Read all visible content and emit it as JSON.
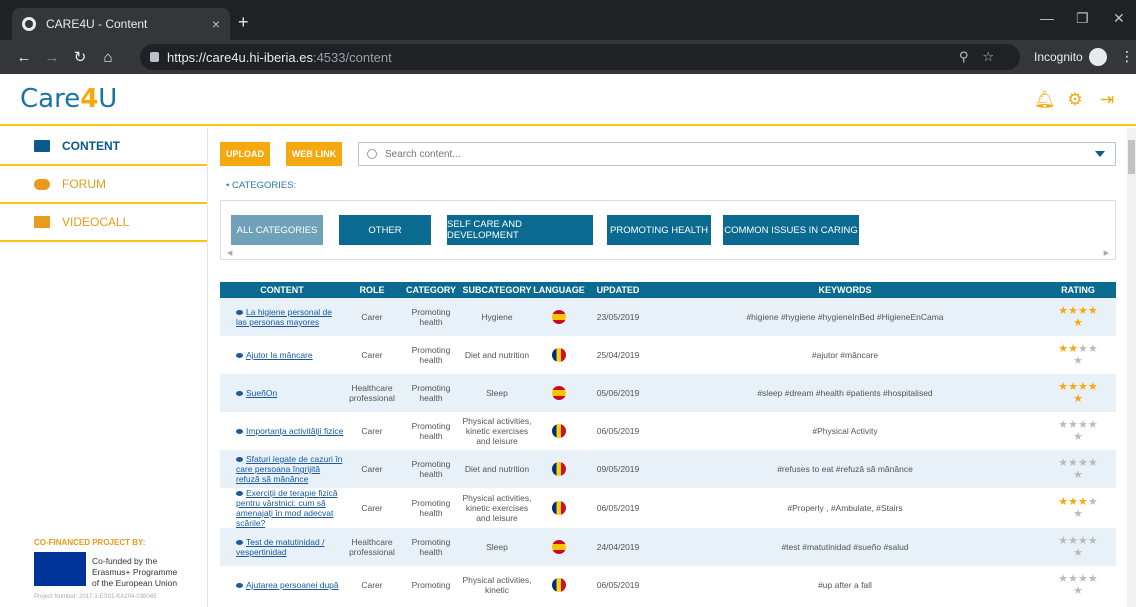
{
  "browser": {
    "tab_title": "CARE4U - Content",
    "tab_close": "×",
    "new_tab": "+",
    "url_main": "https://care4u.hi-iberia.es",
    "url_rest": ":4533/content",
    "incognito_label": "Incognito"
  },
  "header": {
    "logo_prefix": "Care",
    "logo_four": "4",
    "logo_suffix": "U"
  },
  "sidebar": {
    "items": [
      {
        "label": "CONTENT"
      },
      {
        "label": "FORUM"
      },
      {
        "label": "VIDEOCALL"
      }
    ],
    "cofinanced": "CO-FINANCED PROJECT BY:",
    "eu_line1": "Co-funded by the",
    "eu_line2": "Erasmus+ Programme",
    "eu_line3": "of the European Union",
    "project_number": "Project Number: 2017-1-ES01-KA204-038045"
  },
  "toolbar": {
    "upload_label": "UPLOAD",
    "weblink_label": "WEB LINK",
    "search_placeholder": "Search content..."
  },
  "categories": {
    "label": "•  CATEGORIES:",
    "items": [
      "ALL CATEGORIES",
      "OTHER",
      "SELF CARE AND DEVELOPMENT",
      "PROMOTING HEALTH",
      "COMMON ISSUES IN CARING"
    ],
    "selected": "ALL CATEGORIES"
  },
  "table": {
    "headers": [
      "CONTENT",
      "ROLE",
      "CATEGORY",
      "SUBCATEGORY",
      "LANGUAGE",
      "UPDATED",
      "KEYWORDS",
      "RATING"
    ],
    "rows": [
      {
        "content": "La higiene personal de las personas mayores",
        "role": "Carer",
        "category": "Promoting health",
        "subcategory": "Hygiene",
        "language": "es",
        "updated": "23/05/2019",
        "keywords": "#higiene #hygiene #hygieneInBed #HigieneEnCama",
        "rating": 5
      },
      {
        "content": "Ajutor la mâncare",
        "role": "Carer",
        "category": "Promoting health",
        "subcategory": "Diet and nutrition",
        "language": "ro",
        "updated": "25/04/2019",
        "keywords": "#ajutor #mâncare",
        "rating": 2
      },
      {
        "content": "SueñOn",
        "role": "Healthcare professional",
        "category": "Promoting health",
        "subcategory": "Sleep",
        "language": "es",
        "updated": "05/06/2019",
        "keywords": "#sleep #dream #health #patients #hospitalised",
        "rating": 5
      },
      {
        "content": "Importanța activității fizice",
        "role": "Carer",
        "category": "Promoting health",
        "subcategory": "Physical activities, kinetic exercises and leisure",
        "language": "ro",
        "updated": "06/05/2019",
        "keywords": "#Physical Activity",
        "rating": 0
      },
      {
        "content": "Sfaturi legate de cazuri în care persoana îngrijită refuză să mănânce",
        "role": "Carer",
        "category": "Promoting health",
        "subcategory": "Diet and nutrition",
        "language": "ro",
        "updated": "09/05/2019",
        "keywords": "#refuses to eat #refuză să mănânce",
        "rating": 0
      },
      {
        "content": "Exerciții de terapie fizică pentru vârstnici: cum să amenajați în mod adecvat scările?",
        "role": "Carer",
        "category": "Promoting health",
        "subcategory": "Physical activities, kinetic exercises and leisure",
        "language": "ro",
        "updated": "06/05/2019",
        "keywords": "#Properly , #Ambulate, #Stairs",
        "rating": 3
      },
      {
        "content": "Test de matutinidad / vespertinidad",
        "role": "Healthcare professional",
        "category": "Promoting health",
        "subcategory": "Sleep",
        "language": "es",
        "updated": "24/04/2019",
        "keywords": "#test #matutinidad #sueño #salud",
        "rating": 0
      },
      {
        "content": "Ajutarea persoanei după",
        "role": "Carer",
        "category": "Promoting",
        "subcategory": "Physical activities, kinetic",
        "language": "ro",
        "updated": "06/05/2019",
        "keywords": "#up after a fall",
        "rating": 0
      }
    ]
  },
  "colors": {
    "accent_yellow": "#f6a80f",
    "primary_blue": "#0a6a8f",
    "selected_category": "#6fa1b8"
  }
}
